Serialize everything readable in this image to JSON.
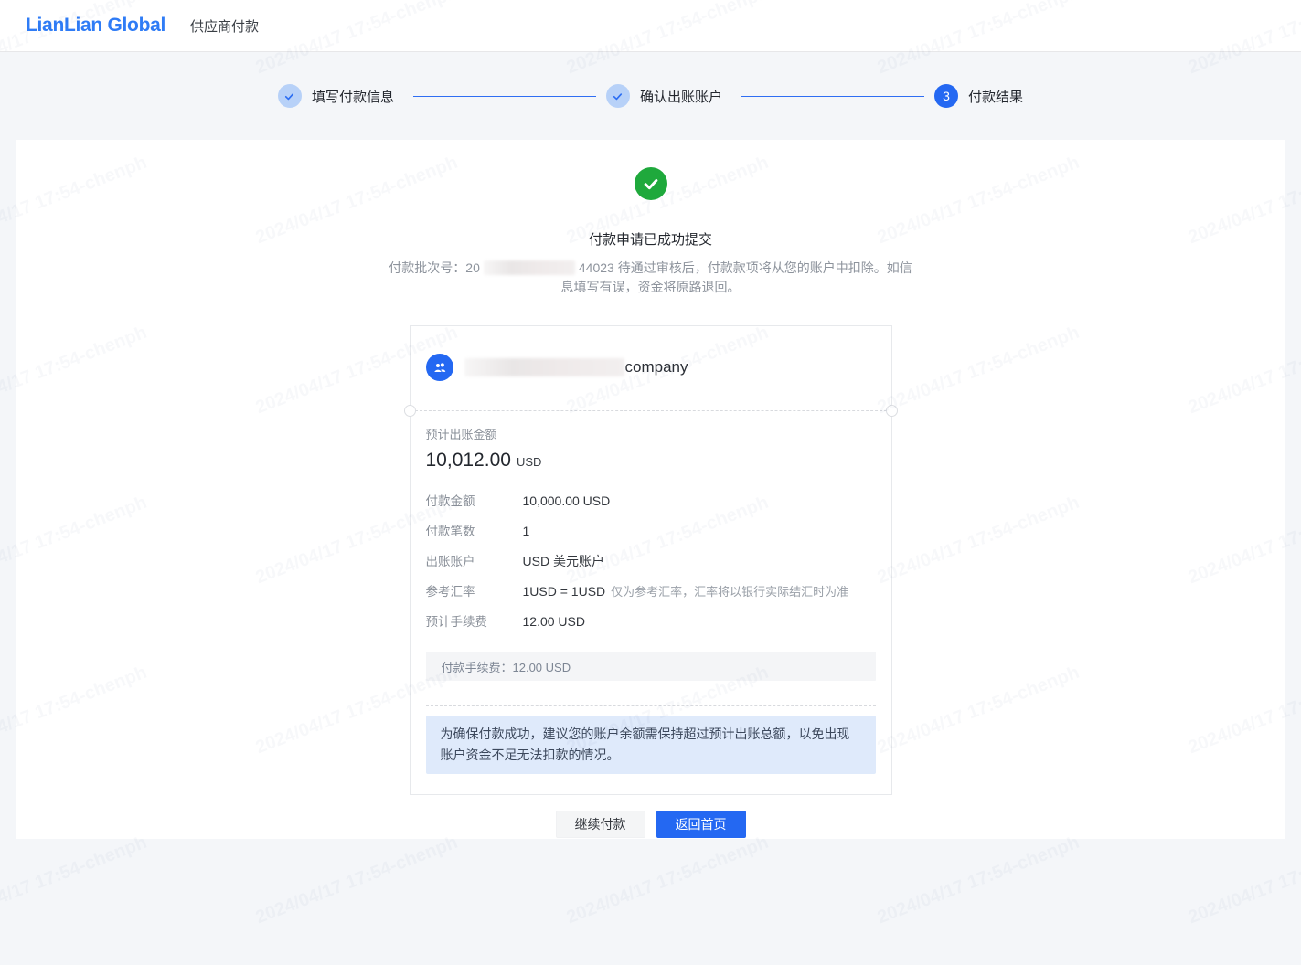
{
  "header": {
    "logo": "LianLian Global",
    "product": "供应商付款"
  },
  "steps": [
    {
      "label": "填写付款信息"
    },
    {
      "label": "确认出账账户"
    },
    {
      "label": "付款结果",
      "number": "3"
    }
  ],
  "result": {
    "title": "付款申请已成功提交",
    "batch_label": "付款批次号：",
    "batch_prefix": "20",
    "batch_suffix": "44023 ",
    "description": "待通过审核后，付款款项将从您的账户中扣除。如信息填写有误，资金将原路退回。"
  },
  "detail": {
    "company_name": "company",
    "amount_label": "预计出账金额",
    "amount_value": "10,012.00",
    "amount_currency": "USD",
    "rows": [
      {
        "label": "付款金额",
        "value": "10,000.00 USD"
      },
      {
        "label": "付款笔数",
        "value": "1"
      },
      {
        "label": "出账账户",
        "value": "USD 美元账户"
      },
      {
        "label": "参考汇率",
        "value": "1USD = 1USD",
        "note": "仅为参考汇率，汇率将以银行实际结汇时为准"
      },
      {
        "label": "预计手续费",
        "value": "12.00 USD"
      }
    ],
    "fee_detail": "付款手续费：12.00 USD",
    "notice": "为确保付款成功，建议您的账户余额需保持超过预计出账总额，以免出现账户资金不足无法扣款的情况。"
  },
  "actions": {
    "continue_label": "继续付款",
    "home_label": "返回首页"
  },
  "watermark": "2024/04/17 17:54-chenph",
  "colors": {
    "accent": "#2468f2",
    "success": "#1fa93c",
    "step_done_bg": "#b7d1f8",
    "notice_bg": "#dfeafb"
  }
}
